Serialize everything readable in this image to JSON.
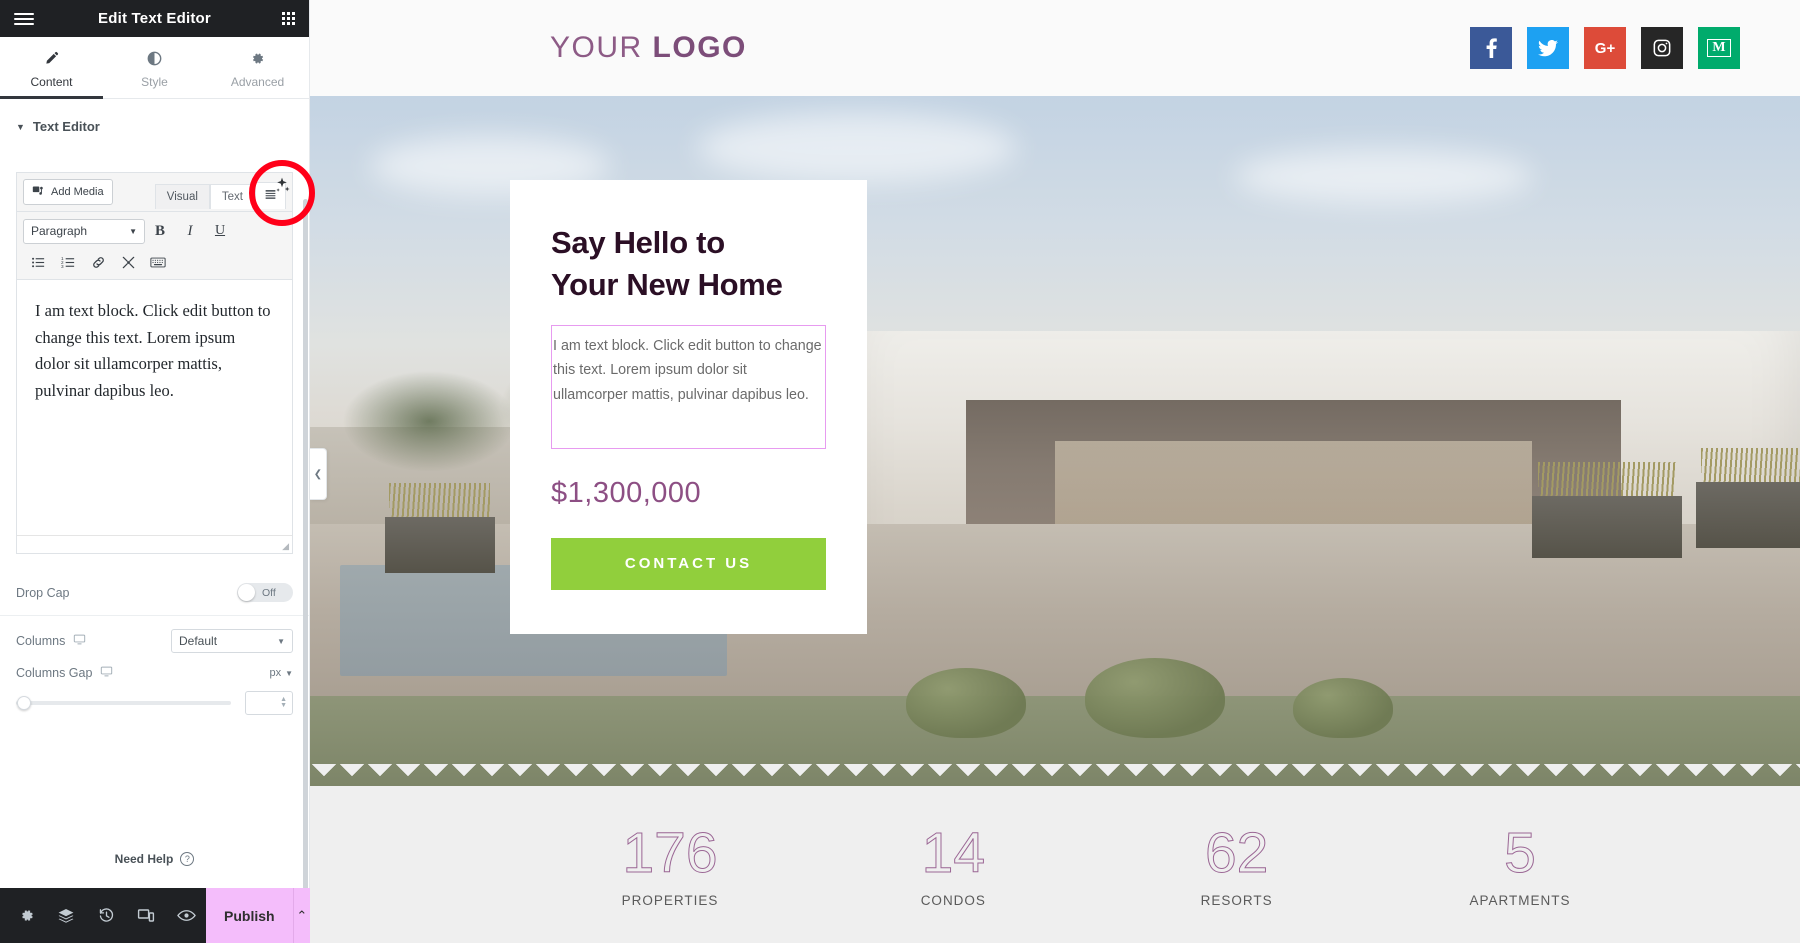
{
  "panel": {
    "header": {
      "title": "Edit Text Editor",
      "menu_icon": "hamburger-icon",
      "apps_icon": "grid-dots-icon"
    },
    "tabs": [
      {
        "label": "Content",
        "icon": "pencil-icon",
        "active": true
      },
      {
        "label": "Style",
        "icon": "contrast-icon",
        "active": false
      },
      {
        "label": "Advanced",
        "icon": "gear-icon",
        "active": false
      }
    ],
    "section": {
      "title": "Text Editor",
      "caret": "▼"
    },
    "editor": {
      "add_media_label": "Add Media",
      "tabs": [
        {
          "label": "Visual",
          "active": true
        },
        {
          "label": "Text",
          "active": false
        }
      ],
      "toolbar_extra_icon": "list-view-icon",
      "format_select_value": "Paragraph",
      "format_buttons": [
        {
          "label": "B",
          "name": "bold-button"
        },
        {
          "label": "I",
          "name": "italic-button"
        },
        {
          "label": "U",
          "name": "underline-button"
        }
      ],
      "tool_icons": [
        "bullet-list-icon",
        "numbered-list-icon",
        "link-icon",
        "insert-more-icon",
        "keyboard-shortcuts-icon"
      ],
      "content": "I am text block. Click edit button to change this text. Lorem ipsum dolor sit ullamcorper mattis, pulvinar dapibus leo."
    },
    "controls": {
      "drop_cap_label": "Drop Cap",
      "drop_cap_state": "Off",
      "columns_label": "Columns",
      "columns_value": "Default",
      "columns_gap_label": "Columns Gap",
      "columns_gap_unit": "px",
      "columns_gap_value": "",
      "device_icon": "desktop-icon"
    },
    "need_help": {
      "label": "Need Help",
      "icon": "question-circle-icon"
    },
    "footer": {
      "icons": [
        "settings-gear-icon",
        "navigator-layers-icon",
        "history-clock-icon",
        "responsive-devices-icon",
        "preview-eye-icon"
      ],
      "publish_label": "Publish",
      "publish_caret": "⌃"
    },
    "collapse_handle_icon": "chevron-left-icon"
  },
  "annotation": {
    "shape": "circle",
    "color": "#ff0019",
    "target_icon": "ai-sparkle-icon"
  },
  "site": {
    "logo": {
      "light": "YOUR",
      "bold": "LOGO",
      "color": "#8d5b86"
    },
    "social": [
      {
        "name": "facebook",
        "glyph": "f",
        "color": "#3b5998"
      },
      {
        "name": "twitter",
        "glyph": "✈",
        "color": "#1da1f2"
      },
      {
        "name": "google-plus",
        "glyph": "G+",
        "color": "#dd4b39"
      },
      {
        "name": "instagram",
        "glyph": "▣",
        "color": "#262626"
      },
      {
        "name": "medium",
        "glyph": "M",
        "color": "#00ab6c"
      }
    ],
    "card": {
      "heading_line1": "Say Hello to",
      "heading_line2": "Your New Home",
      "body": "I am text block. Click edit button to change this text. Lorem ipsum dolor sit ullamcorper mattis, pulvinar dapibus leo.",
      "price": "$1,300,000",
      "cta_label": "CONTACT US",
      "cta_color": "#91cf3c",
      "highlight_color": "#e79bf0"
    },
    "stats": [
      {
        "number": "176",
        "caption": "PROPERTIES"
      },
      {
        "number": "14",
        "caption": "CONDOS"
      },
      {
        "number": "62",
        "caption": "RESORTS"
      },
      {
        "number": "5",
        "caption": "APARTMENTS"
      }
    ]
  }
}
